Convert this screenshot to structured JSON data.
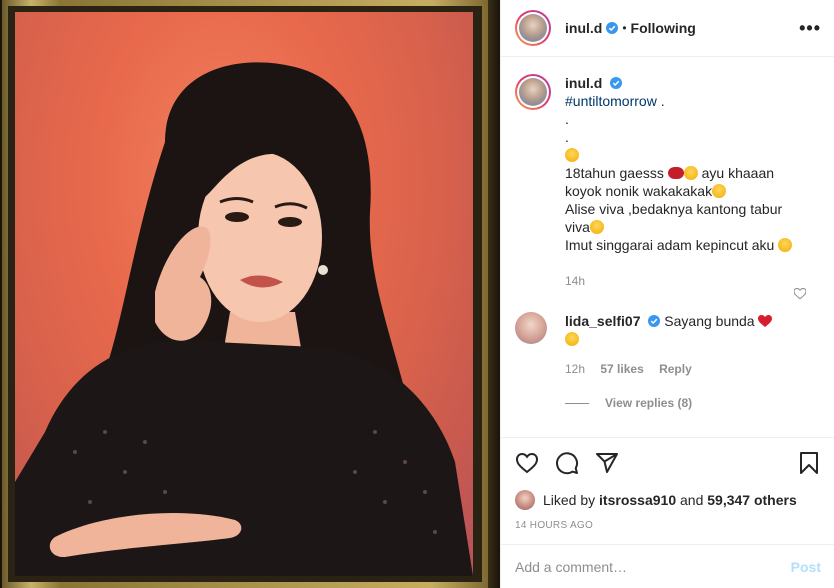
{
  "header": {
    "username": "inul.d",
    "separator": "•",
    "follow_state": "Following",
    "more_label": "•••"
  },
  "caption": {
    "username": "inul.d",
    "hashtag": "#untiltomorrow",
    "lines": [
      " .",
      ".",
      ".",
      "",
      "18tahun gaesss",
      "ayu khaaan",
      "koyok nonik wakakakak",
      "Alise viva ,bedaknya kantong tabur",
      "viva",
      "Imut singgarai adam kepincut aku"
    ],
    "time": "14h"
  },
  "comment": {
    "username": "lida_selfi07",
    "text": "Sayang bunda",
    "time": "12h",
    "likes": "57 likes",
    "reply": "Reply",
    "view_replies": "View replies (8)"
  },
  "likes": {
    "prefix": "Liked by",
    "user": "itsrossa910",
    "and": "and",
    "count": "59,347 others"
  },
  "post_time": "14 HOURS AGO",
  "add_comment": {
    "placeholder": "Add a comment…",
    "post_label": "Post"
  },
  "colors": {
    "link": "#00376b",
    "muted": "#8e8e8e",
    "post_button": "#b2dffc",
    "verified": "#3897f0"
  }
}
